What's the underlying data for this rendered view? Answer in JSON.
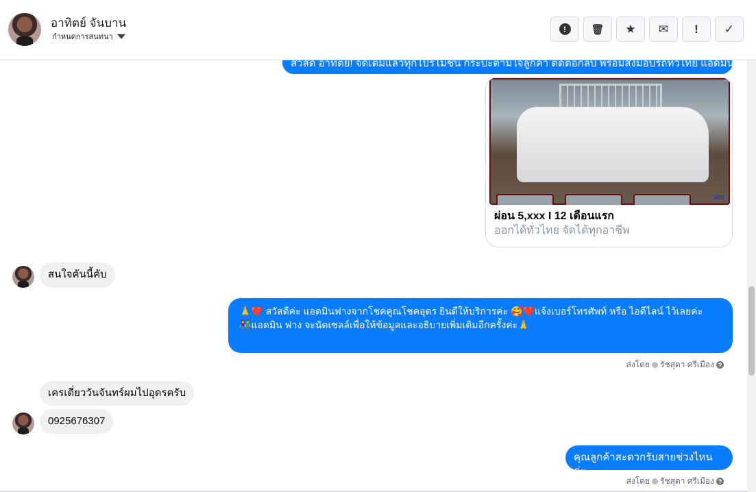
{
  "header": {
    "name": "อาทิตย์ จันบาน",
    "subtitle": "กำหนดการสนทนา",
    "buttons": [
      {
        "name": "report",
        "glyph": "!"
      },
      {
        "name": "delete",
        "glyph": "🗑"
      },
      {
        "name": "star",
        "glyph": "★"
      },
      {
        "name": "mark-unread",
        "glyph": "✉"
      },
      {
        "name": "important",
        "glyph": "!"
      },
      {
        "name": "done",
        "glyph": "✓"
      }
    ]
  },
  "messages": {
    "top_out": "สวัสดี อาทิตย์! จัดเต็มแล้วทุกโปรโมชั่น กระบะตามใจลูกค้า ติดต่อกลับ พร้อมส่งมอบรถทั่วไทย แอดมินเลย",
    "card": {
      "title": "ผ่อน 5,xxx I 12 เดือนแรก",
      "subtitle": "ออกได้ทั่วไทย จัดได้ทุกอาชีพ",
      "image_tag": "I009"
    },
    "in1": "สนใจคันนี้คับ",
    "out1_l1": "🙏❤️ สวัสดีค่ะ แอดมินฟางจากโชคคูณโชคอุดร ยินดีให้บริการค่ะ 🥰❤️แจ้งเบอร์โทรศัพท์ หรือ ไอดีไลน์ ไว้เลยค่ะ",
    "out1_l2": "👫แอดมิน ฟาง จะนัดเซลล์เพื่อให้ข้อมูลและอธิบายเพิ่มเติมอีกครั้งค่ะ🙏",
    "sent_by_label": "ส่งโดย",
    "sender": "รัชสุดา ศรีเมือง",
    "help": "?",
    "in2": "เครเดี่ยววันจันทร์ผมไปอุดรครับ",
    "in3": "0925676307",
    "out2": "คุณลูกค้าสะดวกรับสายช่วงไหนค่ะ"
  },
  "colors": {
    "outgoing": "#0a7cff",
    "incoming": "#f0f0f0"
  }
}
